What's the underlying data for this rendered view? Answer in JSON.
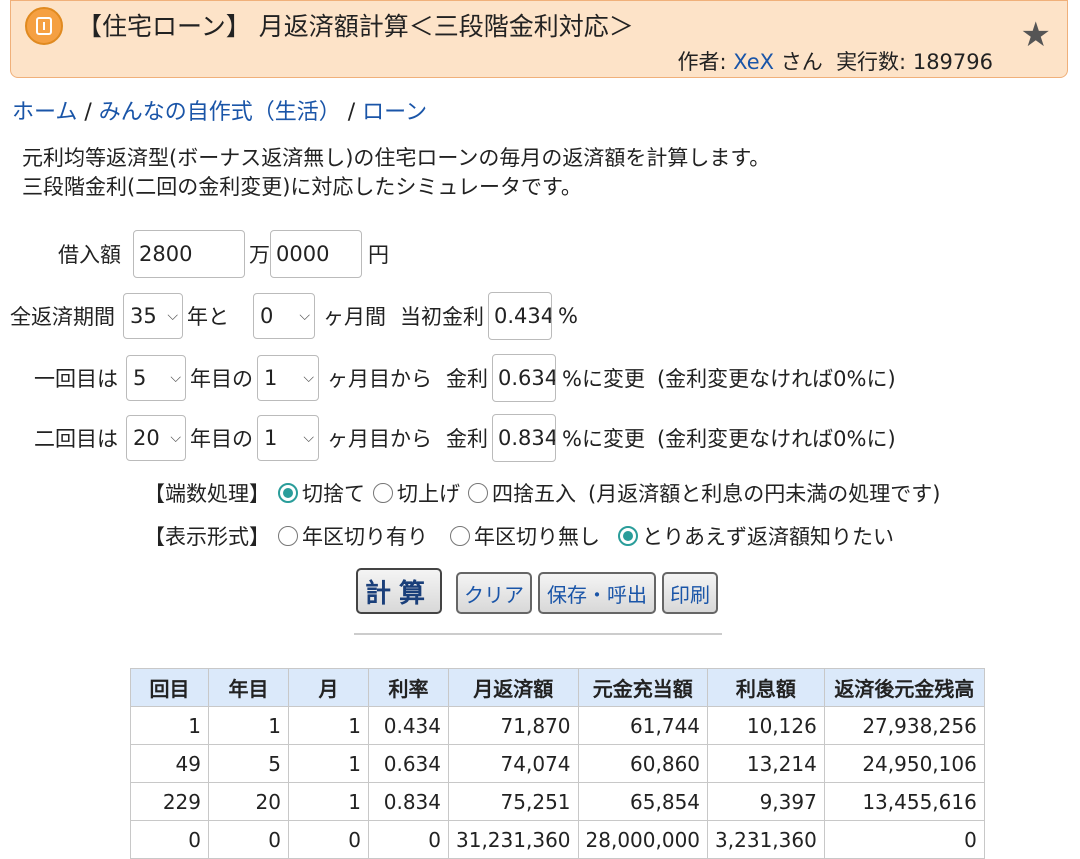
{
  "header": {
    "title": "【住宅ローン】 月返済額計算＜三段階金利対応＞",
    "author_prefix": "作者: ",
    "author_name": "XeX",
    "author_suffix": " さん",
    "exec_label": "実行数: ",
    "exec_count": "189796",
    "icon": "calculator-icon",
    "star_icon": "star-icon",
    "star_glyph": "★"
  },
  "breadcrumb": {
    "home": "ホーム",
    "sep1": " / ",
    "category": "みんなの自作式（生活）",
    "sep2": " / ",
    "current": "ローン"
  },
  "description": {
    "line1": "元利均等返済型(ボーナス返済無し)の住宅ローンの毎月の返済額を計算します。",
    "line2": "三段階金利(二回の金利変更)に対応したシミュレータです。"
  },
  "form": {
    "loan_label": "借入額",
    "loan_man": "2800",
    "man_unit": "万",
    "loan_yen": "0000",
    "yen_unit": "円",
    "period_label": "全返済期間",
    "period_years": "35",
    "years_and": "年と",
    "period_months": "0",
    "months_unit": "ヶ月間",
    "initial_rate_label": "当初金利",
    "initial_rate": "0.434",
    "percent": "%",
    "first_label": "一回目は",
    "first_year": "5",
    "year_of": "年目の",
    "first_month": "1",
    "month_from": "ヶ月目から",
    "rate_label": "金利",
    "first_rate": "0.634",
    "change_to": "%に変更",
    "note": "(金利変更なければ0%に)",
    "second_label": "二回目は",
    "second_year": "20",
    "second_month": "1",
    "second_rate": "0.834",
    "rounding_label": "【端数処理】",
    "rounding_options": [
      "切捨て",
      "切上げ",
      "四捨五入"
    ],
    "rounding_note": "(月返済額と利息の円未満の処理です)",
    "display_label": "【表示形式】",
    "display_options": [
      "年区切り有り",
      "年区切り無し",
      "とりあえず返済額知りたい"
    ]
  },
  "buttons": {
    "calculate": "計算",
    "clear": "クリア",
    "save": "保存・呼出",
    "print": "印刷"
  },
  "table": {
    "headers": [
      "回目",
      "年目",
      "月",
      "利率",
      "月返済額",
      "元金充当額",
      "利息額",
      "返済後元金残高"
    ],
    "rows": [
      [
        "1",
        "1",
        "1",
        "0.434",
        "71,870",
        "61,744",
        "10,126",
        "27,938,256"
      ],
      [
        "49",
        "5",
        "1",
        "0.634",
        "74,074",
        "60,860",
        "13,214",
        "24,950,106"
      ],
      [
        "229",
        "20",
        "1",
        "0.834",
        "75,251",
        "65,854",
        "9,397",
        "13,455,616"
      ],
      [
        "0",
        "0",
        "0",
        "0",
        "31,231,360",
        "28,000,000",
        "3,231,360",
        "0"
      ]
    ]
  }
}
